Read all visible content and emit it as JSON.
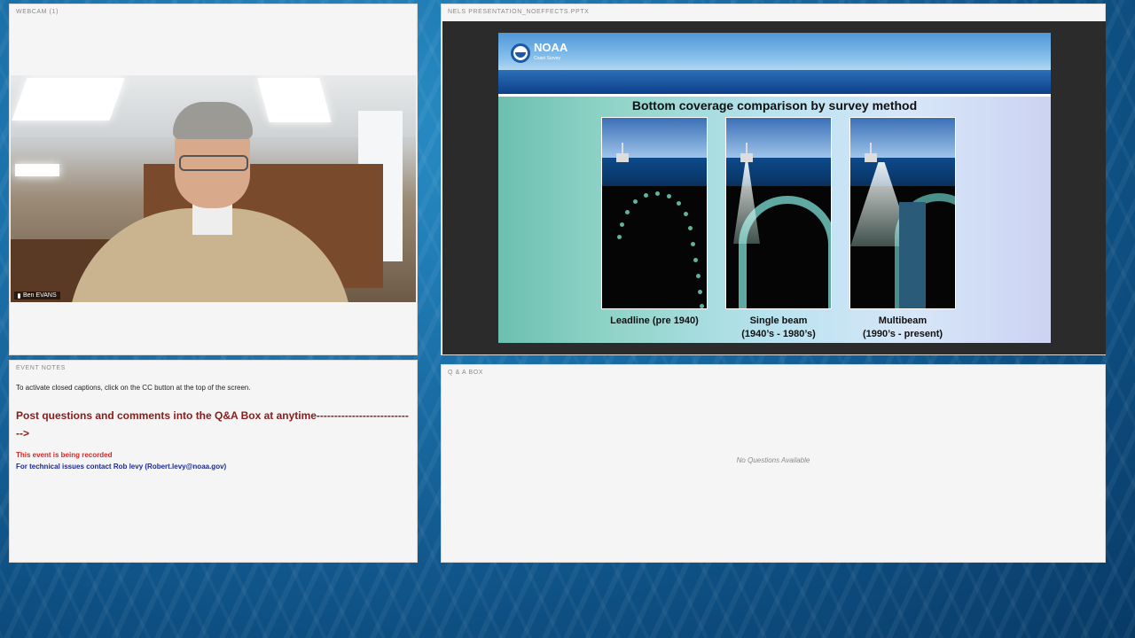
{
  "webcam": {
    "title": "WEBCAM (1)",
    "participant_name": "Ben EVANS"
  },
  "presentation": {
    "title": "NELS PRESENTATION_NOEFFECTS.PPTX",
    "slide": {
      "logo_text": "NOAA",
      "logo_subtext": "Coast Survey",
      "heading": "Bottom coverage comparison by survey method",
      "panels": [
        {
          "line1": "Leadline (pre 1940)",
          "line2": ""
        },
        {
          "line1": "Single beam",
          "line2": "(1940’s - 1980’s)"
        },
        {
          "line1": "Multibeam",
          "line2": "(1990’s - present)"
        }
      ]
    }
  },
  "event_notes": {
    "title": "EVENT NOTES",
    "cc_instruction": "To activate closed captions,  click on the CC button at the top of the screen.",
    "post_questions": "Post questions and comments into the  Q&A Box at anytime---------------------------->",
    "recorded": "This event is being recorded",
    "tech_contact": "For technical issues contact Rob levy (Robert.levy@noaa.gov)"
  },
  "qa_box": {
    "title": "Q & A BOX",
    "empty_message": "No Questions Available"
  },
  "colors": {
    "post_text": "#8b1a1a",
    "recorded_text": "#d02a2a",
    "tech_text": "#1a2a9a",
    "background": "#1a6fa8"
  }
}
